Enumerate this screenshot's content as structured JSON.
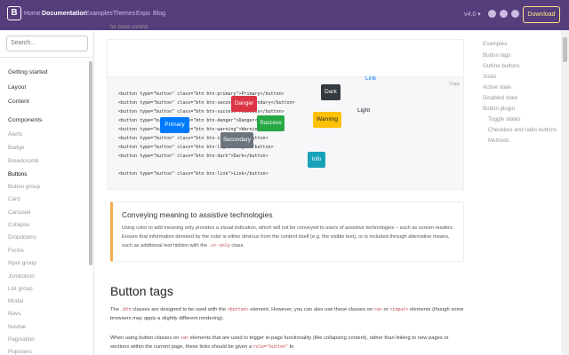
{
  "navbar": {
    "brand": "B",
    "links": [
      "Home",
      "Documentation",
      "Examples",
      "Themes",
      "Expo",
      "Blog"
    ],
    "version": "v4.0 ▾",
    "download": "Download"
  },
  "sidebar": {
    "search_placeholder": "Search...",
    "sections": [
      "Getting started",
      "Layout",
      "Content",
      "Components"
    ],
    "components": [
      "Alerts",
      "Badge",
      "Breadcrumb",
      "Buttons",
      "Button group",
      "Card",
      "Carousel",
      "Collapse",
      "Dropdowns",
      "Forms",
      "Input group",
      "Jumbotron",
      "List group",
      "Modal",
      "Navs",
      "Navbar",
      "Pagination",
      "Popovers"
    ]
  },
  "main": {
    "top_text": "for more control",
    "copy_label": "Copy",
    "example_buttons": {
      "primary": "Primary",
      "secondary": "Secondary",
      "success": "Success",
      "danger": "Danger",
      "warning": "Warning",
      "info": "Info",
      "light": "Light",
      "dark": "Dark",
      "link": "Link"
    },
    "code_lines": [
      "<button type=\"button\" class=\"btn btn-primary\">Primary</button>",
      "<button type=\"button\" class=\"btn btn-secondary\">Secondary</button>",
      "<button type=\"button\" class=\"btn btn-success\">Success</button>",
      "<button type=\"button\" class=\"btn btn-danger\">Danger</button>",
      "<button type=\"button\" class=\"btn btn-warning\">Warning</button>",
      "<button type=\"button\" class=\"btn btn-info\">Info</button>",
      "<button type=\"button\" class=\"btn btn-light\">Light</button>",
      "<button type=\"button\" class=\"btn btn-dark\">Dark</button>",
      "",
      "<button type=\"button\" class=\"btn btn-link\">Link</button>"
    ],
    "callout_title": "Conveying meaning to assistive technologies",
    "callout_text_1": "Using color to add meaning only provides a visual indication, which will not be conveyed to users of assistive technologies – such as screen readers. Ensure that information denoted by the color is either obvious from the content itself (e.g. the visible text), or is included through alternative means, such as additional text hidden with the ",
    "callout_code": ".sr-only",
    "callout_text_2": " class.",
    "heading": "Button tags",
    "para1_a": "The ",
    "para1_code1": ".btn",
    "para1_b": " classes are designed to be used with the ",
    "para1_code2": "<button>",
    "para1_c": " element. However, you can also use these classes on ",
    "para1_code3": "<a>",
    "para1_d": " or ",
    "para1_code4": "<input>",
    "para1_e": " elements (though some browsers may apply a slightly different rendering).",
    "para2_a": "When using button classes on ",
    "para2_code1": "<a>",
    "para2_b": " elements that are used to trigger in-page functionality (like collapsing content), rather than linking to new pages or sections within the current page, these links should be given a ",
    "para2_code2": "role=\"button\"",
    "para2_c": " to"
  },
  "toc": [
    "Examples",
    "Button tags",
    "Outline buttons",
    "Sizes",
    "Active state",
    "Disabled state",
    "Button plugin",
    "Toggle states",
    "Checkbox and radio buttons",
    "Methods"
  ],
  "colors": {
    "navbar": "#563d7c",
    "download": "#ffe484",
    "callout_border": "#f0ad4e"
  }
}
